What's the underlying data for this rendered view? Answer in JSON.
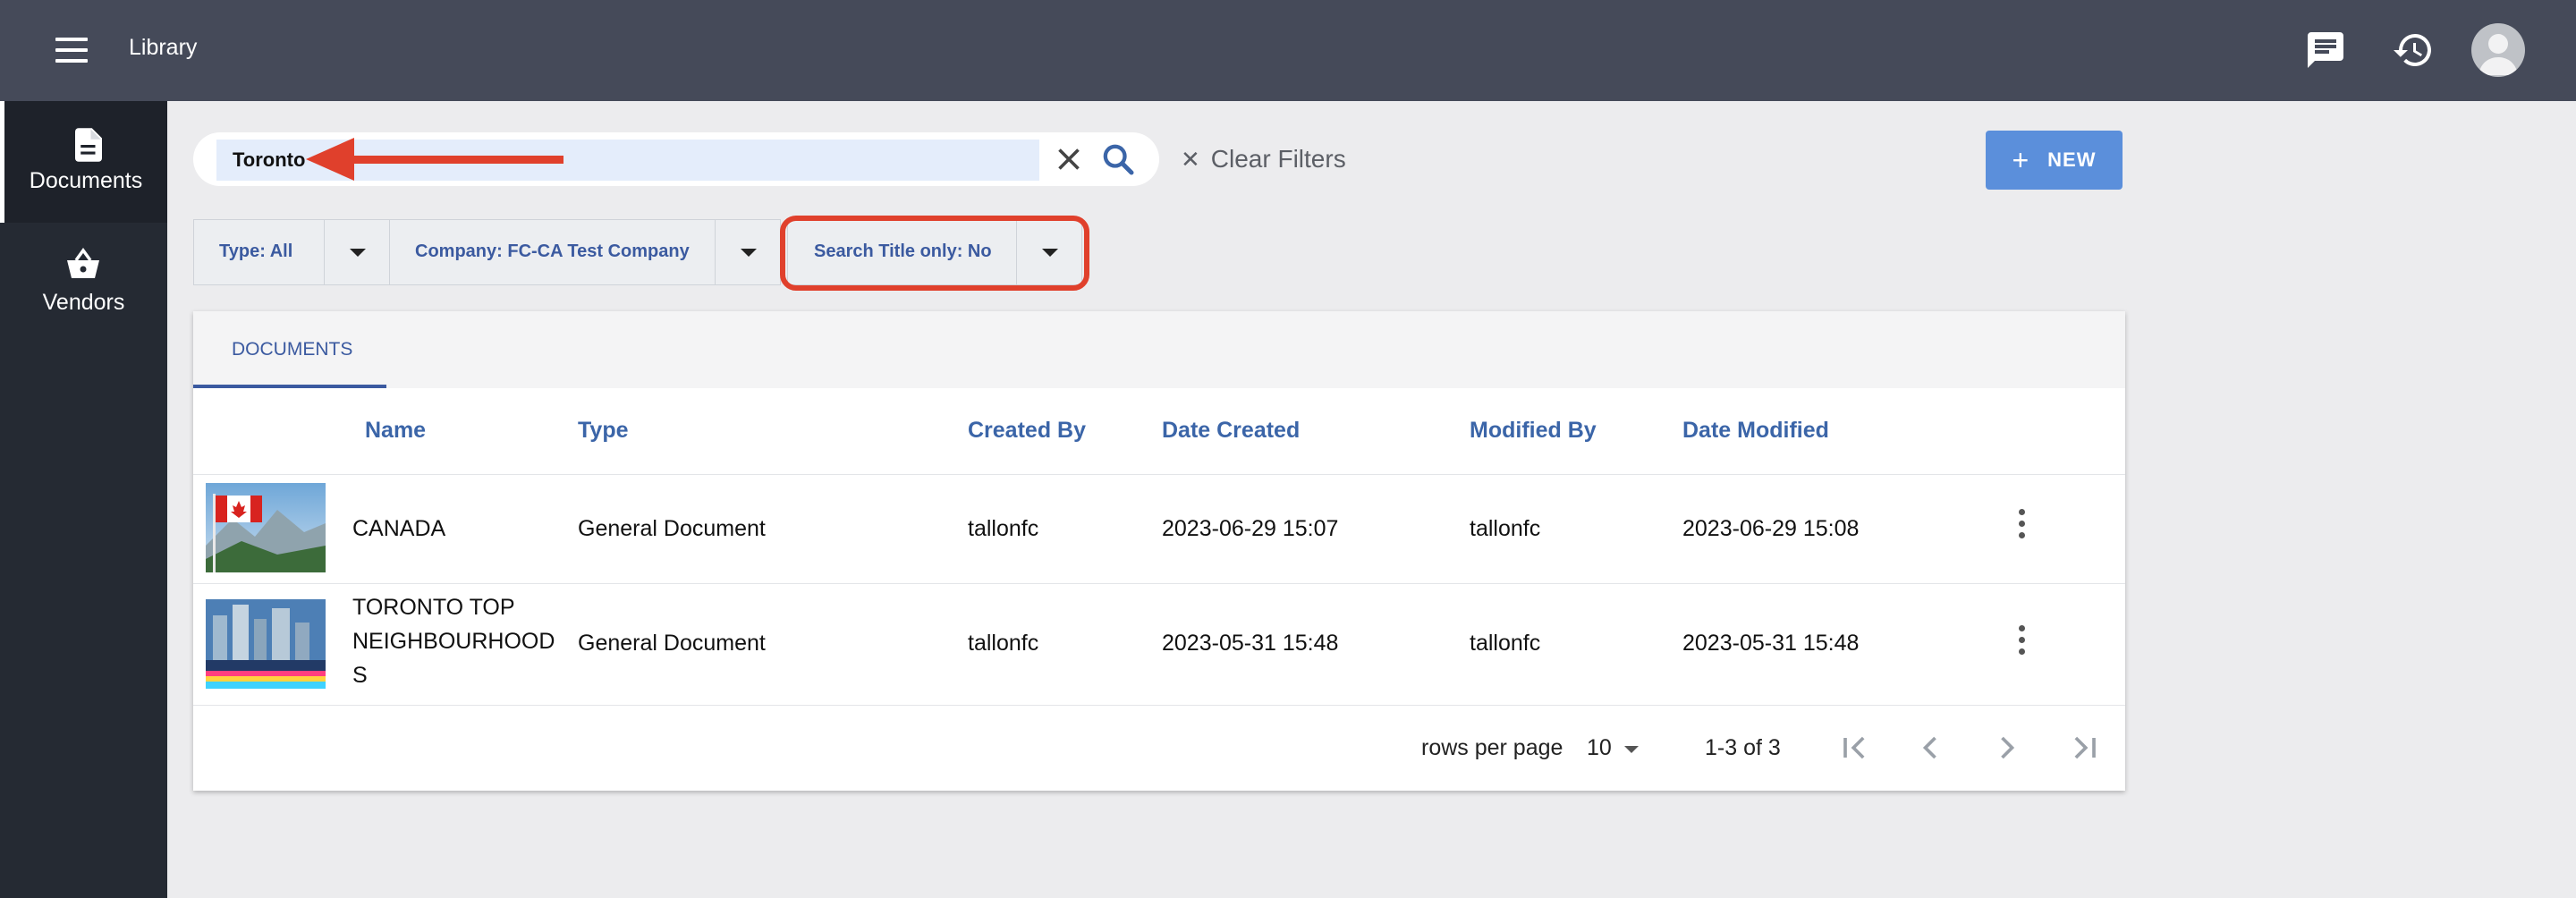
{
  "topbar": {
    "title": "Library"
  },
  "sidebar": {
    "items": [
      {
        "label": "Documents"
      },
      {
        "label": "Vendors"
      }
    ]
  },
  "search": {
    "value": "Toronto",
    "clear_filters_label": "Clear Filters",
    "new_label": "NEW"
  },
  "filters": [
    {
      "key": "Type:",
      "value": "All"
    },
    {
      "key": "Company:",
      "value": "FC-CA Test Company"
    },
    {
      "key": "Search Title only:",
      "value": "No"
    }
  ],
  "tabs": [
    {
      "label": "DOCUMENTS"
    }
  ],
  "table": {
    "columns": [
      "Name",
      "Type",
      "Created By",
      "Date Created",
      "Modified By",
      "Date Modified"
    ],
    "rows": [
      {
        "name": [
          "CANADA"
        ],
        "type": "General Document",
        "created_by": "tallonfc",
        "date_created": "2023-06-29 15:07",
        "modified_by": "tallonfc",
        "date_modified": "2023-06-29 15:08"
      },
      {
        "name": [
          "TORONTO TOP",
          "NEIGHBOURHOOD",
          "S"
        ],
        "type": "General Document",
        "created_by": "tallonfc",
        "date_created": "2023-05-31 15:48",
        "modified_by": "tallonfc",
        "date_modified": "2023-05-31 15:48"
      }
    ]
  },
  "pagination": {
    "rows_per_page_label": "rows per page",
    "rows_per_page": "10",
    "range": "1-3 of 3"
  },
  "annotation": {
    "arrow_color": "#e0402c",
    "highlight_color": "#e0402c"
  },
  "colors": {
    "accent": "#3b65a8",
    "topbar": "#454a59",
    "sidebar": "#252a33",
    "new_button": "#5b8fdb"
  }
}
